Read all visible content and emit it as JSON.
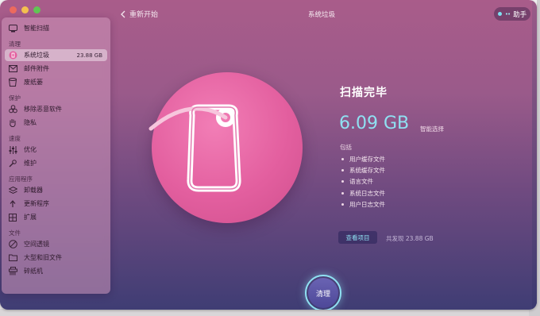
{
  "header": {
    "back_label": "重新开始",
    "title": "系统垃圾",
    "assistant_label": "助手"
  },
  "sidebar": {
    "top_item": {
      "label": "智能扫描",
      "icon": "smart-scan-icon"
    },
    "sections": [
      {
        "label": "清理",
        "items": [
          {
            "label": "系统垃圾",
            "size": "23.88 GB",
            "icon": "system-junk-icon",
            "active": true
          },
          {
            "label": "邮件附件",
            "icon": "mail-icon"
          },
          {
            "label": "废纸篓",
            "icon": "trash-icon"
          }
        ]
      },
      {
        "label": "保护",
        "items": [
          {
            "label": "移除恶意软件",
            "icon": "biohazard-icon"
          },
          {
            "label": "隐私",
            "icon": "hand-icon"
          }
        ]
      },
      {
        "label": "速度",
        "items": [
          {
            "label": "优化",
            "icon": "sliders-icon"
          },
          {
            "label": "维护",
            "icon": "wrench-icon"
          }
        ]
      },
      {
        "label": "应用程序",
        "items": [
          {
            "label": "卸载器",
            "icon": "uninstaller-icon"
          },
          {
            "label": "更新程序",
            "icon": "updater-icon"
          },
          {
            "label": "扩展",
            "icon": "extensions-icon"
          }
        ]
      },
      {
        "label": "文件",
        "items": [
          {
            "label": "空间透镜",
            "icon": "space-lens-icon"
          },
          {
            "label": "大型和旧文件",
            "icon": "folder-icon"
          },
          {
            "label": "碎纸机",
            "icon": "shredder-icon"
          }
        ]
      }
    ]
  },
  "result": {
    "title": "扫描完毕",
    "size": "6.09 GB",
    "smart_select": "智能选择",
    "includes_label": "包括",
    "includes": [
      "用户缓存文件",
      "系统缓存文件",
      "语言文件",
      "系统日志文件",
      "用户日志文件"
    ],
    "review_button": "查看项目",
    "found_text": "共发现 23.88 GB"
  },
  "clean_button": "清理",
  "colors": {
    "accent": "#8fe1f2",
    "hero_pink": "#e35f9f"
  }
}
